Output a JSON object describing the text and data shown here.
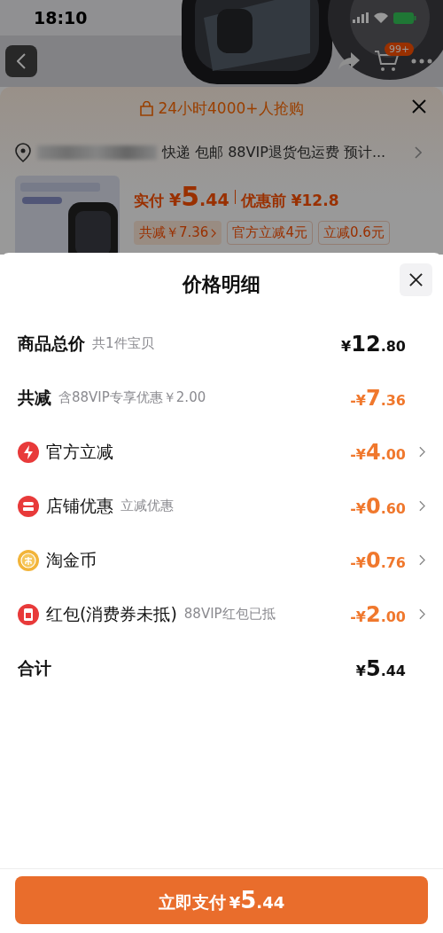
{
  "status_bar": {
    "time": "18:10"
  },
  "product_nav": {
    "cart_badge": "99+"
  },
  "purchase_panel": {
    "banner": "24小时4000+人抢购",
    "address": "快递 包邮 88VIP退货包运费 预计...",
    "pay_label": "实付",
    "pay_amount": "¥5.44",
    "original_price": "优惠前 ¥12.8",
    "tags": [
      {
        "label": "共减￥7.36",
        "kind": "link"
      },
      {
        "label": "官方立减4元",
        "kind": "plain"
      },
      {
        "label": "立减0.6元",
        "kind": "plain"
      }
    ]
  },
  "sheet": {
    "title": "价格明细",
    "rows": [
      {
        "kind": "summary",
        "label": "商品总价",
        "note": "共1件宝贝",
        "amount": "¥12.80",
        "accent": false,
        "chevron": false
      },
      {
        "kind": "summary",
        "label": "共减",
        "note": "含88VIP专享优惠￥2.00",
        "amount": "-¥7.36",
        "accent": true,
        "chevron": false
      },
      {
        "kind": "official",
        "label": "官方立减",
        "amount": "-¥4.00",
        "accent": true,
        "chevron": true
      },
      {
        "kind": "store",
        "label": "店铺优惠",
        "note": "立减优惠",
        "amount": "-¥0.60",
        "accent": true,
        "chevron": true
      },
      {
        "kind": "coins",
        "label": "淘金币",
        "amount": "-¥0.76",
        "accent": true,
        "chevron": true
      },
      {
        "kind": "voucher",
        "label": "红包(消费券未抵)",
        "note": "88VIP红包已抵",
        "amount": "-¥2.00",
        "accent": true,
        "chevron": true
      },
      {
        "kind": "total",
        "label": "合计",
        "amount": "¥5.44",
        "accent": false,
        "chevron": false
      }
    ],
    "pay_button": {
      "label": "立即支付",
      "amount": "¥5.44"
    }
  }
}
